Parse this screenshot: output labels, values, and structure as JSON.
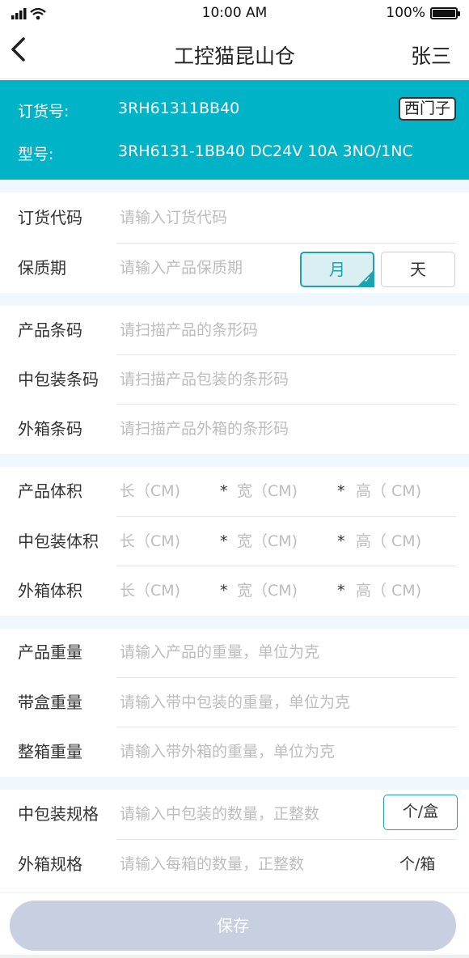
{
  "status_bar": {
    "time": "10:00 AM",
    "battery": "100%"
  },
  "nav": {
    "title": "工控猫昆山仓",
    "user": "张三"
  },
  "product": {
    "order_label": "订货号:",
    "order_value": "3RH61311BB40",
    "model_label": "型号:",
    "model_value": "3RH6131-1BB40 DC24V 10A 3NO/1NC",
    "brand": "西门子"
  },
  "form": {
    "order_code": {
      "label": "订货代码",
      "placeholder": "请输入订货代码"
    },
    "shelf_life": {
      "label": "保质期",
      "placeholder": "请输入产品保质期",
      "unit_month": "月",
      "unit_day": "天",
      "selected": "月"
    },
    "product_barcode": {
      "label": "产品条码",
      "placeholder": "请扫描产品的条形码"
    },
    "package_barcode": {
      "label": "中包装条码",
      "placeholder": "请扫描产品包装的条形码"
    },
    "carton_barcode": {
      "label": "外箱条码",
      "placeholder": "请扫描产品外箱的条形码"
    },
    "dims": {
      "length": "长（CM)",
      "width": "宽（CM)",
      "height": "高（ CM)",
      "times": "*"
    },
    "product_volume": {
      "label": "产品体积"
    },
    "package_volume": {
      "label": "中包装体积"
    },
    "carton_volume": {
      "label": "外箱体积"
    },
    "product_weight": {
      "label": "产品重量",
      "placeholder": "请输入产品的重量，单位为克"
    },
    "box_weight": {
      "label": "带盒重量",
      "placeholder": "请输入带中包装的重量，单位为克"
    },
    "carton_weight": {
      "label": "整箱重量",
      "placeholder": "请输入带外箱的重量，单位为克"
    },
    "package_spec": {
      "label": "中包装规格",
      "placeholder": "请输入中包装的数量，正整数",
      "unit": "个/盒"
    },
    "carton_spec": {
      "label": "外箱规格",
      "placeholder": "请输入每箱的数量，正整数",
      "unit": "个/箱"
    }
  },
  "footer": {
    "save": "保存"
  },
  "colors": {
    "accent": "#00b3c6",
    "save_disabled": "#c8cfe0",
    "section_bg": "#f0f7fd"
  }
}
